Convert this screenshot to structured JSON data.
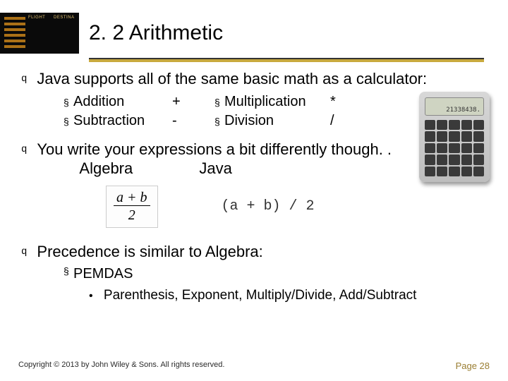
{
  "header": {
    "board_col1": "FLIGHT",
    "board_col2": "DESTINA",
    "title": "2. 2 Arithmetic"
  },
  "bullets": {
    "b1": "Java supports all of the same basic math as a calculator:",
    "ops": {
      "add": "Addition",
      "add_sym": "+",
      "sub": "Subtraction",
      "sub_sym": "-",
      "mul": "Multiplication",
      "mul_sym": "*",
      "div": "Division",
      "div_sym": "/"
    },
    "b2": "You write your expressions a bit differently though. .",
    "col_a": "Algebra",
    "col_j": "Java",
    "frac_top": "a + b",
    "frac_bot": "2",
    "java_expr": "(a + b) / 2",
    "b3": "Precedence is similar to Algebra:",
    "pemdas": "PEMDAS",
    "pemdas_detail": "Parenthesis, Exponent, Multiply/Divide, Add/Subtract"
  },
  "calculator": {
    "display": "21338438."
  },
  "footer": {
    "copyright": "Copyright © 2013 by John Wiley & Sons.  All rights reserved.",
    "page": "Page 28"
  }
}
